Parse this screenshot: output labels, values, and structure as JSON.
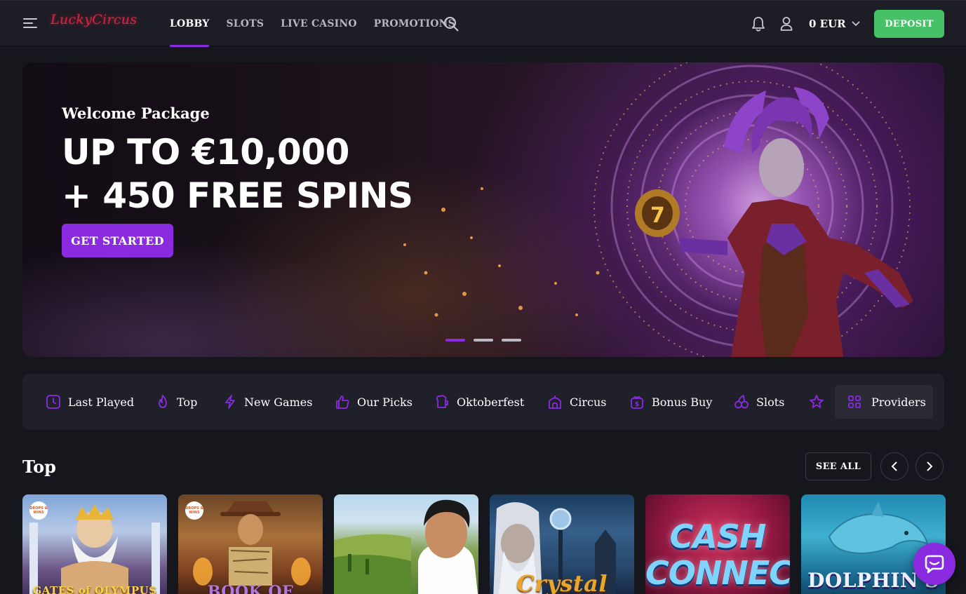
{
  "brand": {
    "logo_text": "LuckyCircus"
  },
  "nav": {
    "items": [
      {
        "label": "LOBBY",
        "active": true
      },
      {
        "label": "SLOTS",
        "active": false
      },
      {
        "label": "LIVE CASINO",
        "active": false
      },
      {
        "label": "PROMOTIONS",
        "active": false
      }
    ]
  },
  "header": {
    "balance": "0 EUR",
    "deposit_label": "DEPOSIT",
    "icons": [
      "menu-icon",
      "search-icon",
      "bell-icon",
      "user-icon",
      "chevron-down-icon"
    ]
  },
  "hero": {
    "subtitle": "Welcome Package",
    "title_line1": "UP TO €10,000",
    "title_line2": "+ 450 FREE SPINS",
    "cta_label": "GET STARTED",
    "slide_count": 3,
    "active_slide": 1
  },
  "categories": {
    "items": [
      {
        "label": "Last Played",
        "icon": "clock-icon"
      },
      {
        "label": "Top",
        "icon": "flame-icon"
      },
      {
        "label": "New Games",
        "icon": "lightning-icon"
      },
      {
        "label": "Our Picks",
        "icon": "thumbs-up-icon"
      },
      {
        "label": "Oktoberfest",
        "icon": "beer-mug-icon"
      },
      {
        "label": "Circus",
        "icon": "circus-tent-icon"
      },
      {
        "label": "Bonus Buy",
        "icon": "gift-bag-icon"
      },
      {
        "label": "Slots",
        "icon": "cherries-icon"
      },
      {
        "label": "",
        "icon": "star-icon"
      }
    ],
    "providers_label": "Providers",
    "accent_color": "#8a2be2"
  },
  "top_section": {
    "title": "Top",
    "see_all_label": "SEE ALL",
    "games": [
      {
        "title": "GATES of OLYMPUS",
        "badge": "DROPS & WINS"
      },
      {
        "title": "BOOK OF",
        "badge": "DROPS & WINS"
      },
      {
        "title": ""
      },
      {
        "title": "Crystal"
      },
      {
        "title": "CASH CONNECTION"
      },
      {
        "title": "DOLPHIN'S"
      }
    ]
  },
  "colors": {
    "accent": "#8a2be2",
    "deposit": "#46c168",
    "background": "#16161d"
  }
}
